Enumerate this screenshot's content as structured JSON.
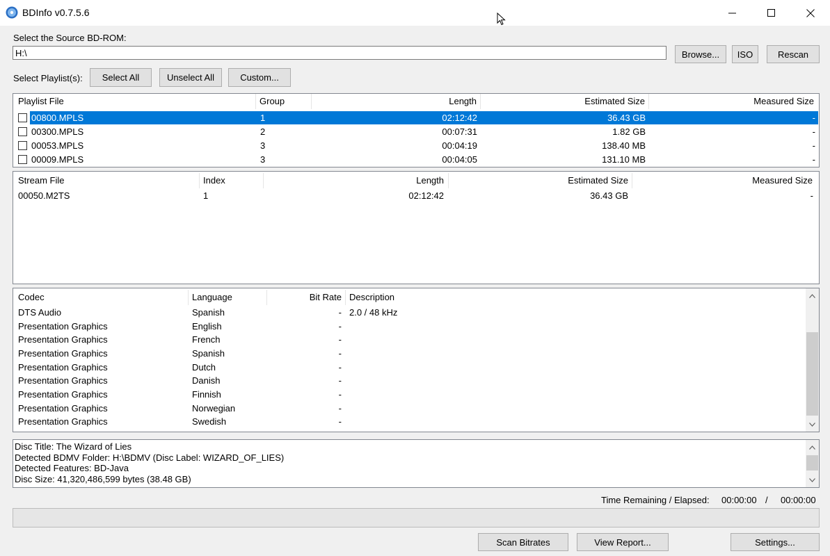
{
  "window": {
    "title": "BDInfo v0.7.5.6",
    "icon": "disc-icon",
    "controls": [
      "minimize-icon",
      "maximize-icon",
      "close-icon"
    ]
  },
  "source": {
    "label": "Select the Source BD-ROM:",
    "path": "H:\\",
    "browse_label": "Browse...",
    "iso_label": "ISO",
    "rescan_label": "Rescan"
  },
  "playlist_select": {
    "label": "Select Playlist(s):",
    "select_all_label": "Select All",
    "unselect_all_label": "Unselect All",
    "custom_label": "Custom..."
  },
  "playlists": {
    "columns": [
      "Playlist File",
      "Group",
      "Length",
      "Estimated Size",
      "Measured Size"
    ],
    "rows": [
      {
        "file": "00800.MPLS",
        "group": "1",
        "length": "02:12:42",
        "est": "36.43 GB",
        "meas": "-",
        "selected": true
      },
      {
        "file": "00300.MPLS",
        "group": "2",
        "length": "00:07:31",
        "est": "1.82 GB",
        "meas": "-"
      },
      {
        "file": "00053.MPLS",
        "group": "3",
        "length": "00:04:19",
        "est": "138.40 MB",
        "meas": "-"
      },
      {
        "file": "00009.MPLS",
        "group": "3",
        "length": "00:04:05",
        "est": "131.10 MB",
        "meas": "-"
      }
    ]
  },
  "streams": {
    "columns": [
      "Stream File",
      "Index",
      "Length",
      "Estimated Size",
      "Measured Size"
    ],
    "rows": [
      {
        "file": "00050.M2TS",
        "index": "1",
        "length": "02:12:42",
        "est": "36.43 GB",
        "meas": "-"
      }
    ]
  },
  "codecs": {
    "columns": [
      "Codec",
      "Language",
      "Bit Rate",
      "Description"
    ],
    "rows": [
      {
        "codec": "DTS Audio",
        "lang": "Spanish",
        "bitrate": "-",
        "desc": "2.0 / 48 kHz"
      },
      {
        "codec": "Presentation Graphics",
        "lang": "English",
        "bitrate": "-",
        "desc": ""
      },
      {
        "codec": "Presentation Graphics",
        "lang": "French",
        "bitrate": "-",
        "desc": ""
      },
      {
        "codec": "Presentation Graphics",
        "lang": "Spanish",
        "bitrate": "-",
        "desc": ""
      },
      {
        "codec": "Presentation Graphics",
        "lang": "Dutch",
        "bitrate": "-",
        "desc": ""
      },
      {
        "codec": "Presentation Graphics",
        "lang": "Danish",
        "bitrate": "-",
        "desc": ""
      },
      {
        "codec": "Presentation Graphics",
        "lang": "Finnish",
        "bitrate": "-",
        "desc": ""
      },
      {
        "codec": "Presentation Graphics",
        "lang": "Norwegian",
        "bitrate": "-",
        "desc": ""
      },
      {
        "codec": "Presentation Graphics",
        "lang": "Swedish",
        "bitrate": "-",
        "desc": ""
      }
    ]
  },
  "info": {
    "lines": [
      "Disc Title: The Wizard of Lies",
      "Detected BDMV Folder: H:\\BDMV (Disc Label: WIZARD_OF_LIES)",
      "Detected Features: BD-Java",
      "Disc Size: 41,320,486,599 bytes (38.48 GB)"
    ]
  },
  "status": {
    "time_label": "Time Remaining / Elapsed:",
    "remaining": "00:00:00",
    "separator": "/",
    "elapsed": "00:00:00",
    "progress": 0
  },
  "actions": {
    "scan_label": "Scan Bitrates",
    "report_label": "View Report...",
    "settings_label": "Settings..."
  }
}
